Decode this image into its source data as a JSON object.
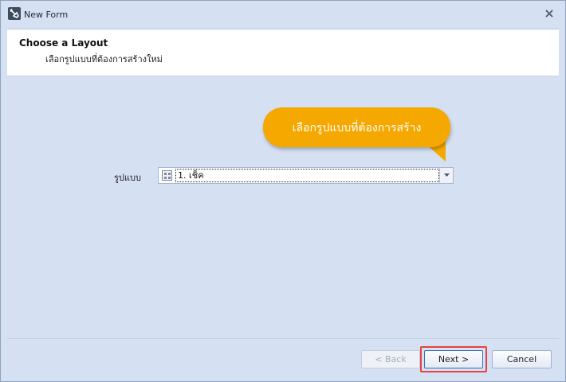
{
  "window": {
    "title": "New Form",
    "icon": "form-tool-icon",
    "close_icon": "close-icon"
  },
  "header": {
    "title": "Choose a Layout",
    "subtitle": "เลือกรูปแบบที่ต้องการสร้างใหม่"
  },
  "callout": {
    "text": "เลือกรูปแบบที่ต้องการสร้าง",
    "color": "#f5a800"
  },
  "layout_field": {
    "label": "รูปแบบ",
    "value": "1. เช็ค",
    "icon": "layout-grid-icon"
  },
  "buttons": {
    "back": "< Back",
    "next": "Next >",
    "cancel": "Cancel"
  },
  "colors": {
    "window_bg": "#d5e1f2",
    "highlight": "#e8413e"
  }
}
